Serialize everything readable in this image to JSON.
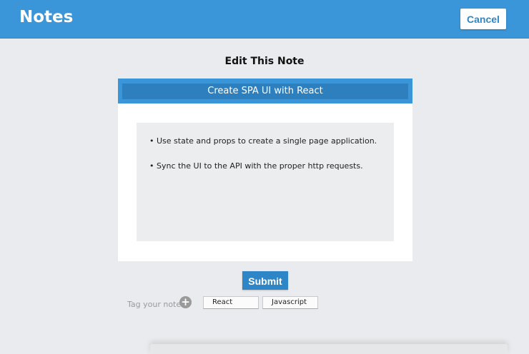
{
  "header": {
    "title": "Notes",
    "cancel_label": "Cancel"
  },
  "editor": {
    "heading": "Edit This Note",
    "note_title": "Create SPA UI with React",
    "body_lines": [
      "• Use state and props to create a single page application.",
      "• Sync the UI to the API with the proper http requests."
    ],
    "submit_label": "Submit"
  },
  "tags": {
    "label": "Tag your note:",
    "add_icon": "plus-circle-icon",
    "items": [
      "React",
      "Javascript"
    ]
  },
  "colors": {
    "primary": "#3a96d9",
    "primary_dark": "#2f86c6",
    "background": "#e9ebee"
  }
}
